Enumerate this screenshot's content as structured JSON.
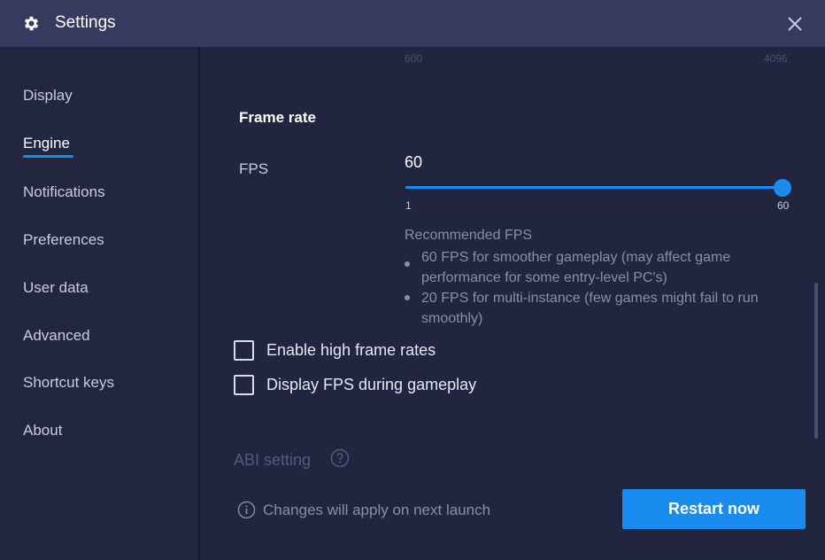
{
  "window": {
    "title": "Settings",
    "icon": "gear-icon",
    "close_icon": "close-icon"
  },
  "sidebar": {
    "items": [
      {
        "label": "Display"
      },
      {
        "label": "Engine",
        "active": true
      },
      {
        "label": "Notifications"
      },
      {
        "label": "Preferences"
      },
      {
        "label": "User data"
      },
      {
        "label": "Advanced"
      },
      {
        "label": "Shortcut keys"
      },
      {
        "label": "About"
      }
    ]
  },
  "resolution_scale": {
    "min_label": "600",
    "max_label": "4096"
  },
  "frame_rate": {
    "section_title": "Frame rate",
    "fps_label": "FPS",
    "fps_value": "60",
    "slider_min": "1",
    "slider_max": "60",
    "slider_fraction": 1.0,
    "recommended_title": "Recommended FPS",
    "recommendations": [
      "60 FPS for smoother gameplay (may affect game performance for some entry-level PC's)",
      "20 FPS for multi-instance (few games might fail to run smoothly)"
    ]
  },
  "options": {
    "high_frame_rates": {
      "label": "Enable high frame rates",
      "checked": false
    },
    "display_fps": {
      "label": "Display FPS during gameplay",
      "checked": false
    }
  },
  "abi": {
    "title": "ABI setting",
    "help_icon": "help-circle-icon"
  },
  "footer": {
    "note": "Changes will apply on next launch",
    "info_icon": "info-icon",
    "restart_label": "Restart now"
  },
  "colors": {
    "accent": "#1a8cf0",
    "background": "#22253f",
    "titlebar": "#353a5e"
  }
}
